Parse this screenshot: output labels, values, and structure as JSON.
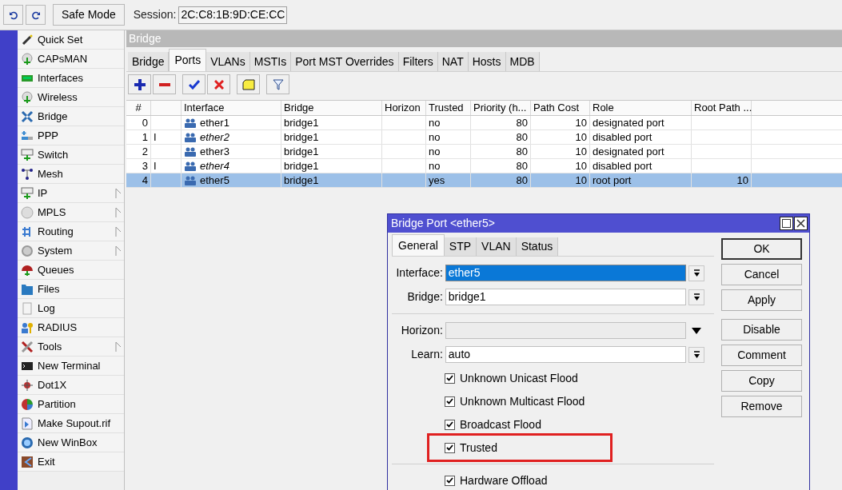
{
  "top_bar": {
    "safe_mode": "Safe Mode",
    "session_label": "Session:",
    "session_value": "2C:C8:1B:9D:CE:CC"
  },
  "sidebar": {
    "items": [
      {
        "label": "Quick Set",
        "submenu": false
      },
      {
        "label": "CAPsMAN",
        "submenu": false
      },
      {
        "label": "Interfaces",
        "submenu": false
      },
      {
        "label": "Wireless",
        "submenu": false
      },
      {
        "label": "Bridge",
        "submenu": false
      },
      {
        "label": "PPP",
        "submenu": false
      },
      {
        "label": "Switch",
        "submenu": false
      },
      {
        "label": "Mesh",
        "submenu": false
      },
      {
        "label": "IP",
        "submenu": true
      },
      {
        "label": "MPLS",
        "submenu": true
      },
      {
        "label": "Routing",
        "submenu": true
      },
      {
        "label": "System",
        "submenu": true
      },
      {
        "label": "Queues",
        "submenu": false
      },
      {
        "label": "Files",
        "submenu": false
      },
      {
        "label": "Log",
        "submenu": false
      },
      {
        "label": "RADIUS",
        "submenu": false
      },
      {
        "label": "Tools",
        "submenu": true
      },
      {
        "label": "New Terminal",
        "submenu": false
      },
      {
        "label": "Dot1X",
        "submenu": false
      },
      {
        "label": "Partition",
        "submenu": false
      },
      {
        "label": "Make Supout.rif",
        "submenu": false
      },
      {
        "label": "New WinBox",
        "submenu": false
      },
      {
        "label": "Exit",
        "submenu": false
      }
    ]
  },
  "bridge_window": {
    "title": "Bridge",
    "tabs": [
      {
        "label": "Bridge",
        "selected": false
      },
      {
        "label": "Ports",
        "selected": true
      },
      {
        "label": "VLANs",
        "selected": false
      },
      {
        "label": "MSTIs",
        "selected": false
      },
      {
        "label": "Port MST Overrides",
        "selected": false
      },
      {
        "label": "Filters",
        "selected": false
      },
      {
        "label": "NAT",
        "selected": false
      },
      {
        "label": "Hosts",
        "selected": false
      },
      {
        "label": "MDB",
        "selected": false
      }
    ],
    "table": {
      "columns": [
        "#",
        "Interface",
        "Bridge",
        "Horizon",
        "Trusted",
        "Priority (h...",
        "Path Cost",
        "Role",
        "Root Path ..."
      ],
      "rows": [
        {
          "number": "0",
          "interface": "ether1",
          "bridge": "bridge1",
          "trusted": "no",
          "priority": "80",
          "path_cost": "10",
          "role": "designated port",
          "selected": false,
          "inactive": false
        },
        {
          "number": "1",
          "flag": "I",
          "interface": "ether2",
          "bridge": "bridge1",
          "trusted": "no",
          "priority": "80",
          "path_cost": "10",
          "role": "disabled port",
          "selected": false,
          "inactive": true
        },
        {
          "number": "2",
          "interface": "ether3",
          "bridge": "bridge1",
          "trusted": "no",
          "priority": "80",
          "path_cost": "10",
          "role": "designated port",
          "selected": false,
          "inactive": false
        },
        {
          "number": "3",
          "flag": "I",
          "interface": "ether4",
          "bridge": "bridge1",
          "trusted": "no",
          "priority": "80",
          "path_cost": "10",
          "role": "disabled port",
          "selected": false,
          "inactive": true
        },
        {
          "number": "4",
          "interface": "ether5",
          "bridge": "bridge1",
          "trusted": "yes",
          "priority": "80",
          "path_cost": "10",
          "role": "root port",
          "root_path_cost": "10",
          "selected": true,
          "inactive": false
        }
      ]
    }
  },
  "dialog": {
    "title": "Bridge Port <ether5>",
    "tabs": [
      {
        "label": "General",
        "selected": true
      },
      {
        "label": "STP",
        "selected": false
      },
      {
        "label": "VLAN",
        "selected": false
      },
      {
        "label": "Status",
        "selected": false
      }
    ],
    "sections": [
      {
        "fields": [
          {
            "label": "Interface:",
            "value": "ether5",
            "focused": true,
            "disabled": false
          },
          {
            "label": "Bridge:",
            "value": "bridge1",
            "focused": false,
            "disabled": false
          }
        ]
      },
      {
        "fields": [
          {
            "label": "Horizon:",
            "focused": false,
            "disabled": true
          },
          {
            "label": "Learn:",
            "value": "auto",
            "focused": false,
            "disabled": false
          }
        ],
        "checkboxes": [
          {
            "label": "Unknown Unicast Flood",
            "checked": true,
            "highlighted": false
          },
          {
            "label": "Unknown Multicast Flood",
            "checked": true,
            "highlighted": false
          },
          {
            "label": "Broadcast Flood",
            "checked": true,
            "highlighted": false
          },
          {
            "label": "Trusted",
            "checked": true,
            "highlighted": true
          }
        ]
      },
      {
        "checkboxes": [
          {
            "label": "Hardware Offload",
            "checked": true,
            "highlighted": false
          }
        ]
      }
    ],
    "button_groups": [
      [
        {
          "label": "OK",
          "default": true
        },
        {
          "label": "Cancel",
          "default": false
        },
        {
          "label": "Apply",
          "default": false
        }
      ],
      [
        {
          "label": "Disable",
          "default": false
        },
        {
          "label": "Comment",
          "default": false
        },
        {
          "label": "Copy",
          "default": false
        },
        {
          "label": "Remove",
          "default": false
        }
      ]
    ]
  }
}
